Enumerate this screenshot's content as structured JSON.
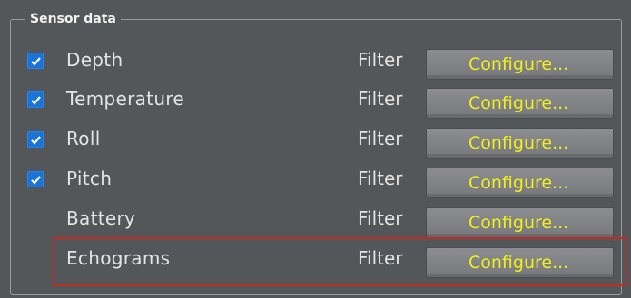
{
  "group": {
    "title": "Sensor data"
  },
  "rows": [
    {
      "label": "Depth",
      "checked": true,
      "filter": "Filter",
      "button": "Configure..."
    },
    {
      "label": "Temperature",
      "checked": true,
      "filter": "Filter",
      "button": "Configure..."
    },
    {
      "label": "Roll",
      "checked": true,
      "filter": "Filter",
      "button": "Configure..."
    },
    {
      "label": "Pitch",
      "checked": true,
      "filter": "Filter",
      "button": "Configure..."
    },
    {
      "label": "Battery",
      "checked": false,
      "filter": "Filter",
      "button": "Configure..."
    },
    {
      "label": "Echograms",
      "checked": false,
      "filter": "Filter",
      "button": "Configure...",
      "highlighted": true
    }
  ],
  "colors": {
    "background": "#54575a",
    "checkbox": "#1a74d8",
    "button_text": "#f2ef1a",
    "highlight": "#c22a25"
  }
}
